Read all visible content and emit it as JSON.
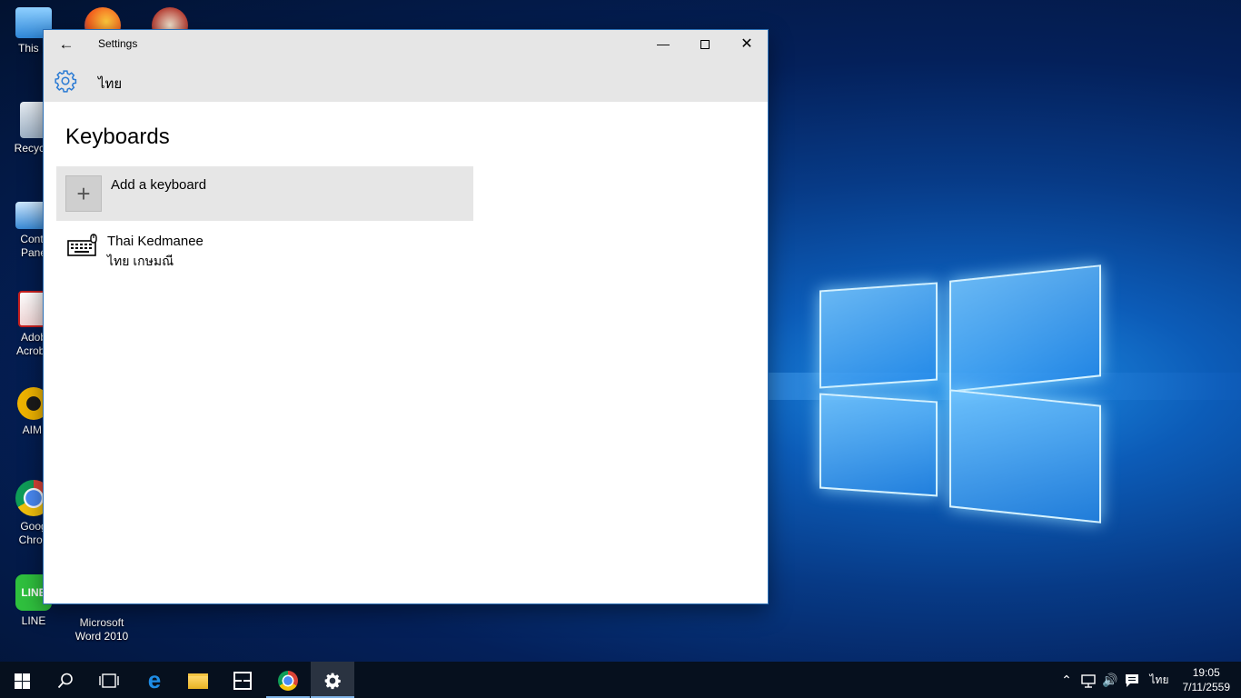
{
  "desktop": {
    "icons": [
      {
        "label": "This P",
        "label2": ""
      },
      {
        "label": "Recycle",
        "label2": ""
      },
      {
        "label": "Contr",
        "label2": "Pane"
      },
      {
        "label": "Adob",
        "label2": "Acroba"
      },
      {
        "label": "AIMI",
        "label2": ""
      },
      {
        "label": "Goog",
        "label2": "Chron"
      },
      {
        "label": "LINE",
        "label2": ""
      },
      {
        "label": "Microsoft",
        "label2": "Word 2010"
      }
    ]
  },
  "window": {
    "title": "Settings",
    "header": "ไทย",
    "page_title": "Keyboards",
    "add_keyboard_label": "Add a keyboard",
    "keyboards": [
      {
        "name": "Thai Kedmanee",
        "subtitle": "ไทย เกษมณี"
      }
    ]
  },
  "taskbar": {
    "language": "ไทย",
    "time": "19:05",
    "date": "7/11/2559"
  },
  "colors": {
    "titlebar": "#e6e6e6",
    "accent": "#2b6fb6",
    "taskbar": "#06101e"
  }
}
